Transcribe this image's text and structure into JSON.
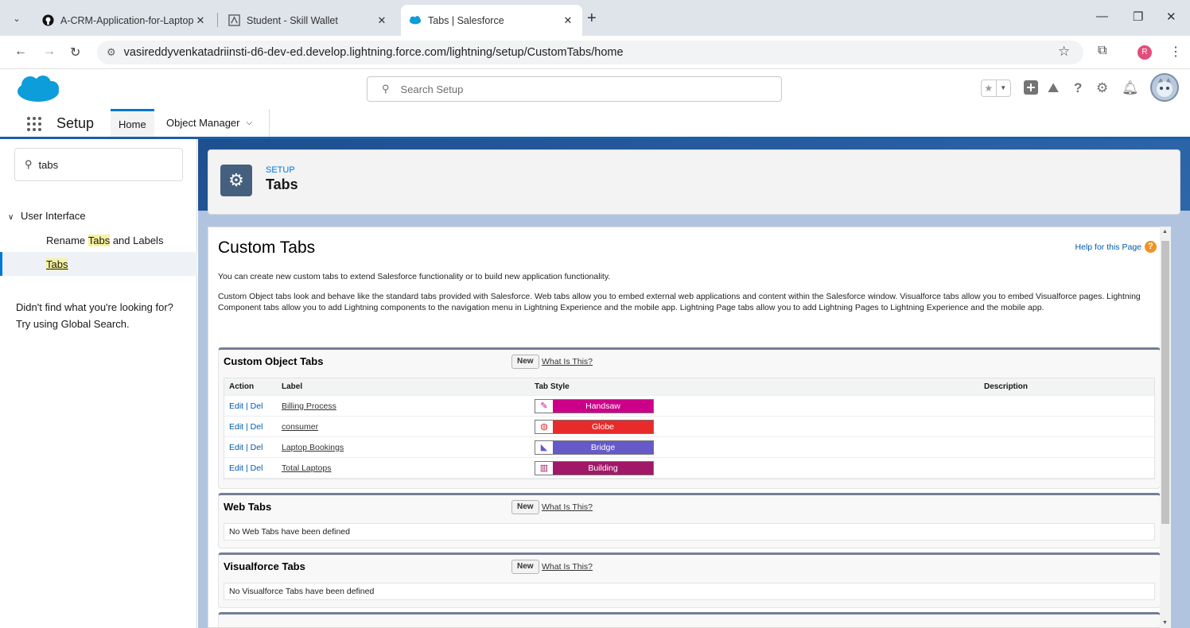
{
  "browser": {
    "tabs": [
      {
        "title": "A-CRM-Application-for-Laptop",
        "icon": "github-icon"
      },
      {
        "title": "Student - Skill Wallet",
        "icon": "skill-wallet-icon"
      },
      {
        "title": "Tabs | Salesforce",
        "icon": "salesforce-cloud-icon"
      }
    ],
    "url": "vasireddyvenkatadriinsti-d6-dev-ed.develop.lightning.force.com/lightning/setup/CustomTabs/home",
    "profile_initial": "R"
  },
  "header": {
    "search_placeholder": "Search Setup"
  },
  "context_nav": {
    "app_name": "Setup",
    "home_label": "Home",
    "object_manager_label": "Object Manager"
  },
  "sidebar": {
    "quick_find_value": "tabs",
    "group_label": "User Interface",
    "items": [
      {
        "pre": "Rename ",
        "highlight": "Tabs",
        "post": " and Labels"
      },
      {
        "pre": "",
        "highlight": "Tabs",
        "post": ""
      }
    ],
    "not_found_line1": "Didn't find what you're looking for?",
    "not_found_line2": "Try using Global Search."
  },
  "page_header": {
    "kicker": "SETUP",
    "title": "Tabs"
  },
  "content": {
    "title": "Custom Tabs",
    "help_link": "Help for this Page",
    "intro": "You can create new custom tabs to extend Salesforce functionality or to build new application functionality.",
    "description": "Custom Object tabs look and behave like the standard tabs provided with Salesforce. Web tabs allow you to embed external web applications and content within the Salesforce window. Visualforce tabs allow you to embed Visualforce pages. Lightning Component tabs allow you to add Lightning components to the navigation menu in Lightning Experience and the mobile app. Lightning Page tabs allow you to add Lightning Pages to Lightning Experience and the mobile app."
  },
  "custom_object_tabs": {
    "title": "Custom Object Tabs",
    "new_label": "New",
    "what_is_this": "What Is This?",
    "columns": [
      "Action",
      "Label",
      "Tab Style",
      "Description"
    ],
    "edit_label": "Edit",
    "del_label": "Del",
    "rows": [
      {
        "label": "Billing Process",
        "style": "Handsaw",
        "color": "#cc0088",
        "icon": "handsaw-icon",
        "glyph": "✎"
      },
      {
        "label": "consumer",
        "style": "Globe",
        "color": "#e82a2a",
        "icon": "globe-icon",
        "glyph": "◍"
      },
      {
        "label": "Laptop Bookings",
        "style": "Bridge",
        "color": "#6659c8",
        "icon": "bridge-icon",
        "glyph": "◣"
      },
      {
        "label": "Total Laptops",
        "style": "Building",
        "color": "#a11869",
        "icon": "building-icon",
        "glyph": "▥"
      }
    ]
  },
  "web_tabs": {
    "title": "Web Tabs",
    "new_label": "New",
    "what_is_this": "What Is This?",
    "empty_text": "No Web Tabs have been defined"
  },
  "visualforce_tabs": {
    "title": "Visualforce Tabs",
    "new_label": "New",
    "what_is_this": "What Is This?",
    "empty_text": "No Visualforce Tabs have been defined"
  }
}
